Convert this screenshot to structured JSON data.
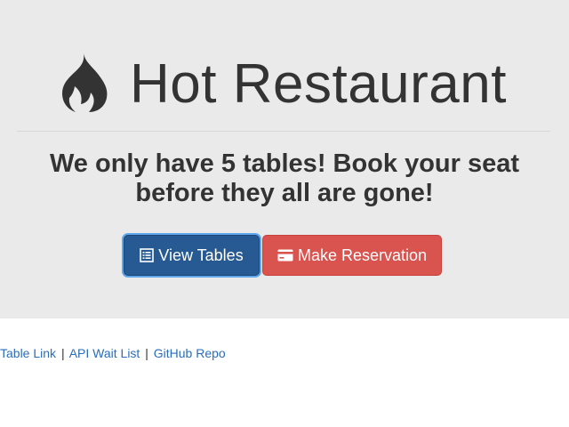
{
  "header": {
    "title": "Hot Restaurant",
    "icon": "fire-icon"
  },
  "subtitle": "We only have 5 tables! Book your seat before they all are gone!",
  "buttons": {
    "view_tables": {
      "label": "View Tables",
      "icon": "list-alt-icon",
      "color": "#275a92"
    },
    "make_reservation": {
      "label": "Make Reservation",
      "icon": "credit-card-icon",
      "color": "#d9534f"
    }
  },
  "footer": {
    "links": [
      "Table Link",
      "API Wait List",
      "GitHub Repo"
    ],
    "separator": "|"
  }
}
